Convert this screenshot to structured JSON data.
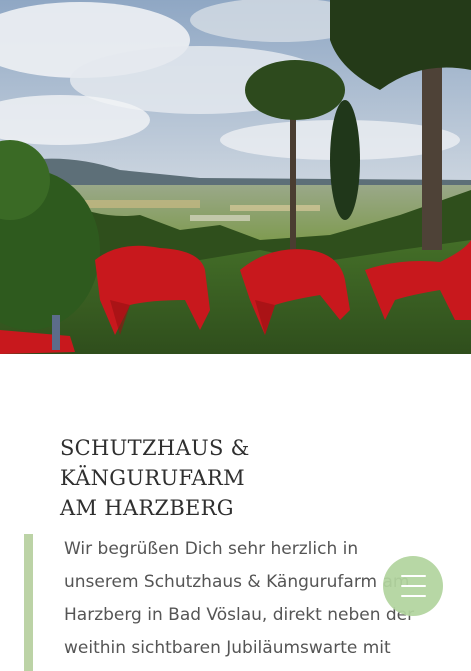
{
  "hero": {
    "image_alt": ""
  },
  "article": {
    "title_line1": "SCHUTZHAUS & KÄNGURUFARM",
    "title_line2": "AM HARZBERG",
    "intro_lines": [
      "Wir begrüßen Dich sehr herzlich in",
      "unserem Schutzhaus & Kängurufarm am",
      "Harzberg in Bad Vöslau, direkt neben der",
      "weithin sichtbaren Jubiläumswarte mit"
    ]
  },
  "menu_button": {
    "icon": "menu-icon"
  },
  "colors": {
    "accent": "#bcd3a6",
    "menu_button": "#b2d49e",
    "title_text": "#2f2f2f",
    "body_text": "#555555"
  }
}
